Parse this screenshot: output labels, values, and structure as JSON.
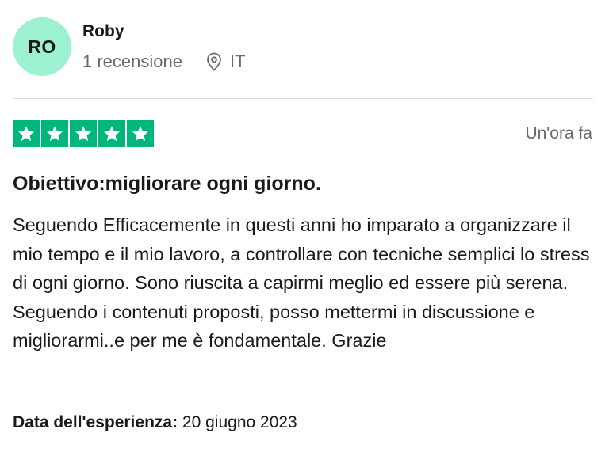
{
  "reviewer": {
    "initials": "RO",
    "avatar_color": "#9cf1d0",
    "name": "Roby",
    "review_count": "1 recensione",
    "country": "IT"
  },
  "review": {
    "rating": 5,
    "max_rating": 5,
    "star_color": "#00b67a",
    "star_icon": "star-icon",
    "time_ago": "Un'ora fa",
    "title": "Obiettivo:migliorare ogni giorno.",
    "text": "Seguendo Efficacemente in questi anni ho imparato a organizzare il mio tempo e il mio lavoro, a controllare con tecniche semplici lo stress di ogni giorno. Sono riuscita a capirmi meglio ed essere più serena. Seguendo i contenuti proposti, posso mettermi in discussione e migliorarmi..e per me è fondamentale. Grazie",
    "experience_label": "Data dell'esperienza:",
    "experience_date": "20 giugno 2023"
  },
  "icons": {
    "location": "location-pin-icon"
  }
}
